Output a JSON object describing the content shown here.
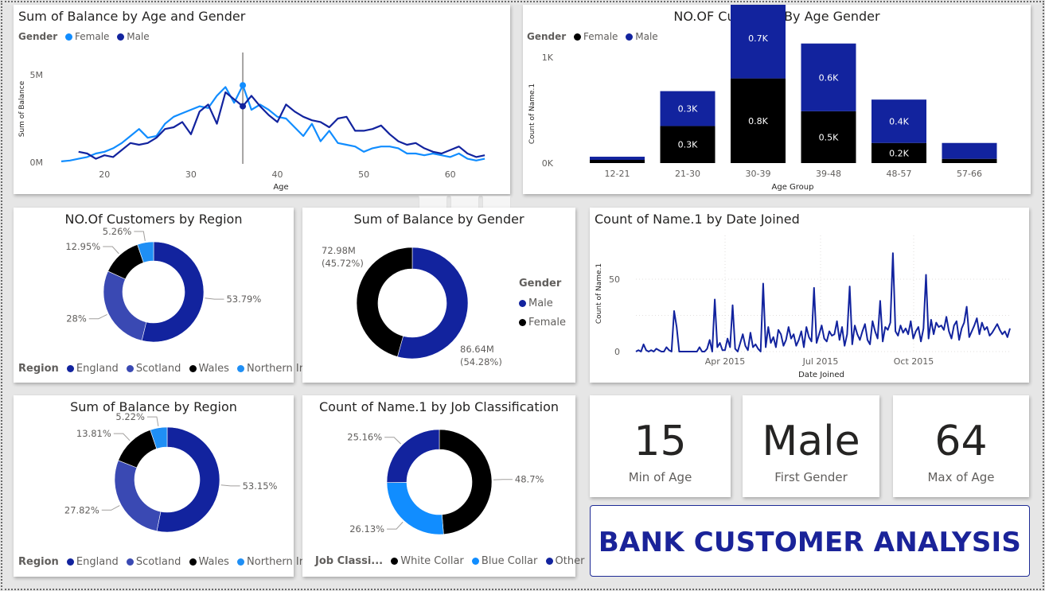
{
  "colors": {
    "female_light": "#118dff",
    "male_dark": "#12239e",
    "black": "#000000",
    "scotland": "#3a49b3",
    "northern_ireland": "#1f8ff5",
    "accent_text": "#1a2399"
  },
  "balance_age_gender": {
    "title": "Sum of Balance by Age and Gender",
    "legend_title": "Gender",
    "legend": [
      "Female",
      "Male"
    ],
    "ylabel": "Sum of Balance",
    "xlabel": "Age",
    "y_ticks": [
      "5M",
      "0M"
    ],
    "x_ticks": [
      "20",
      "30",
      "40",
      "50",
      "60"
    ]
  },
  "customers_age_gender": {
    "title": "NO.OF Customer By Age Gender",
    "legend_title": "Gender",
    "legend": [
      "Female",
      "Male"
    ],
    "ylabel": "Count of Name.1",
    "xlabel": "Age Group",
    "y_ticks": [
      "1K",
      "0K"
    ]
  },
  "customers_region": {
    "title": "NO.Of Customers by Region",
    "legend_title": "Region",
    "legend": [
      "England",
      "Scotland",
      "Wales",
      "Northern Ir..."
    ]
  },
  "balance_gender": {
    "title": "Sum of Balance by Gender",
    "legend_title": "Gender",
    "legend": [
      "Male",
      "Female"
    ],
    "label_female_1": "72.98M",
    "label_female_2": "(45.72%)",
    "label_male_1": "86.64M",
    "label_male_2": "(54.28%)"
  },
  "date_joined": {
    "title": "Count of Name.1 by Date Joined",
    "ylabel": "Count of Name.1",
    "xlabel": "Date Joined",
    "y_ticks": [
      "50",
      "0"
    ],
    "x_ticks": [
      "Apr 2015",
      "Jul 2015",
      "Oct 2015"
    ]
  },
  "balance_region": {
    "title": "Sum of Balance by Region",
    "legend_title": "Region",
    "legend": [
      "England",
      "Scotland",
      "Wales",
      "Northern Ir..."
    ]
  },
  "job_class": {
    "title": "Count of Name.1 by Job Classification",
    "legend_title": "Job Classi...",
    "legend": [
      "White Collar",
      "Blue Collar",
      "Other"
    ]
  },
  "cards": [
    {
      "value": "15",
      "label": "Min of Age"
    },
    {
      "value": "Male",
      "label": "First Gender"
    },
    {
      "value": "64",
      "label": "Max of Age"
    }
  ],
  "banner": "BANK CUSTOMER ANALYSIS",
  "chart_data": [
    {
      "type": "line",
      "title": "Sum of Balance by Age and Gender",
      "xlabel": "Age",
      "ylabel": "Sum of Balance",
      "xlim": [
        15,
        65
      ],
      "ylim": [
        0,
        6
      ],
      "unit": "M",
      "x": [
        15,
        16,
        17,
        18,
        19,
        20,
        21,
        22,
        23,
        24,
        25,
        26,
        27,
        28,
        29,
        30,
        31,
        32,
        33,
        34,
        35,
        36,
        37,
        38,
        39,
        40,
        41,
        42,
        43,
        44,
        45,
        46,
        47,
        48,
        49,
        50,
        51,
        52,
        53,
        54,
        55,
        56,
        57,
        58,
        59,
        60,
        61,
        62,
        63,
        64
      ],
      "series": [
        {
          "name": "Female",
          "color": "#118dff",
          "values": [
            0.05,
            0.1,
            0.2,
            0.3,
            0.5,
            0.6,
            0.8,
            1.1,
            1.5,
            1.9,
            1.4,
            1.5,
            2.2,
            2.6,
            2.8,
            3.0,
            3.2,
            3.1,
            3.8,
            4.3,
            3.4,
            4.4,
            3.0,
            3.3,
            3.0,
            2.6,
            2.5,
            2.0,
            1.5,
            2.2,
            1.2,
            1.8,
            1.1,
            1.0,
            0.9,
            0.6,
            0.8,
            0.9,
            0.9,
            0.8,
            0.5,
            0.5,
            0.4,
            0.5,
            0.4,
            0.3,
            0.5,
            0.2,
            0.1,
            0.2
          ]
        },
        {
          "name": "Male",
          "color": "#12239e",
          "values": [
            null,
            null,
            0.6,
            0.5,
            0.2,
            0.4,
            0.3,
            0.7,
            1.1,
            1.0,
            1.1,
            1.4,
            1.9,
            2.0,
            2.3,
            1.6,
            2.9,
            3.3,
            2.2,
            4.0,
            3.6,
            3.2,
            3.8,
            3.2,
            2.7,
            2.3,
            3.3,
            2.9,
            2.6,
            2.4,
            2.3,
            2.0,
            2.5,
            2.6,
            1.8,
            1.8,
            1.9,
            2.1,
            1.6,
            1.2,
            1.0,
            1.1,
            0.8,
            0.6,
            0.5,
            0.7,
            0.9,
            0.5,
            0.3,
            0.4
          ]
        }
      ]
    },
    {
      "type": "bar",
      "title": "NO.OF Customer By Age Gender",
      "xlabel": "Age Group",
      "ylabel": "Count of Name.1",
      "categories": [
        "12-21",
        "21-30",
        "30-39",
        "39-48",
        "48-57",
        "57-66"
      ],
      "stacked": true,
      "ylim": [
        0,
        1600
      ],
      "series": [
        {
          "name": "Female",
          "color": "#000000",
          "values": [
            30,
            350,
            800,
            490,
            190,
            40
          ],
          "labels": [
            "",
            "0.3K",
            "0.8K",
            "0.5K",
            "0.2K",
            ""
          ]
        },
        {
          "name": "Male",
          "color": "#12239e",
          "values": [
            30,
            330,
            760,
            640,
            410,
            150
          ],
          "labels": [
            "",
            "0.3K",
            "0.7K",
            "0.6K",
            "0.4K",
            ""
          ]
        }
      ]
    },
    {
      "type": "pie",
      "title": "NO.Of Customers by Region",
      "categories": [
        "England",
        "Scotland",
        "Wales",
        "Northern Ir..."
      ],
      "values": [
        53.79,
        28,
        12.95,
        5.26
      ],
      "labels": [
        "53.79%",
        "28%",
        "12.95%",
        "5.26%"
      ],
      "colors": [
        "#12239e",
        "#3a49b3",
        "#000000",
        "#1f8ff5"
      ]
    },
    {
      "type": "pie",
      "title": "Sum of Balance by Gender",
      "categories": [
        "Male",
        "Female"
      ],
      "values": [
        86.64,
        72.98
      ],
      "percent": [
        54.28,
        45.72
      ],
      "colors": [
        "#12239e",
        "#000000"
      ]
    },
    {
      "type": "line",
      "title": "Count of Name.1 by Date Joined",
      "xlabel": "Date Joined",
      "ylabel": "Count of Name.1",
      "x_ticks": [
        "Apr 2015",
        "Jul 2015",
        "Oct 2015"
      ],
      "ylim": [
        0,
        70
      ],
      "series": [
        {
          "name": "",
          "color": "#12239e",
          "values": [
            0,
            1,
            0,
            5,
            1,
            0,
            1,
            0,
            2,
            1,
            0,
            0,
            3,
            1,
            0,
            28,
            17,
            0,
            0,
            0,
            0,
            0,
            0,
            0,
            0,
            3,
            0,
            0,
            2,
            8,
            0,
            36,
            3,
            6,
            1,
            1,
            9,
            3,
            32,
            2,
            0,
            6,
            12,
            4,
            1,
            13,
            3,
            5,
            2,
            0,
            47,
            3,
            17,
            6,
            10,
            3,
            15,
            12,
            4,
            8,
            17,
            9,
            12,
            4,
            8,
            14,
            3,
            17,
            10,
            7,
            44,
            6,
            12,
            18,
            9,
            7,
            14,
            11,
            12,
            21,
            8,
            17,
            4,
            12,
            45,
            5,
            18,
            12,
            8,
            14,
            19,
            8,
            5,
            21,
            14,
            9,
            35,
            7,
            17,
            15,
            20,
            68,
            14,
            11,
            18,
            13,
            16,
            12,
            21,
            9,
            14,
            17,
            7,
            16,
            53,
            9,
            22,
            12,
            20,
            17,
            18,
            15,
            24,
            14,
            9,
            18,
            21,
            8,
            16,
            20,
            31,
            10,
            14,
            18,
            23,
            12,
            20,
            15,
            17,
            11,
            13,
            16,
            19,
            15,
            12,
            14,
            10,
            16
          ]
        }
      ]
    },
    {
      "type": "pie",
      "title": "Sum of Balance by Region",
      "categories": [
        "England",
        "Scotland",
        "Wales",
        "Northern Ir..."
      ],
      "values": [
        53.15,
        27.82,
        13.81,
        5.22
      ],
      "labels": [
        "53.15%",
        "27.82%",
        "13.81%",
        "5.22%"
      ],
      "colors": [
        "#12239e",
        "#3a49b3",
        "#000000",
        "#1f8ff5"
      ]
    },
    {
      "type": "pie",
      "title": "Count of Name.1 by Job Classification",
      "categories": [
        "White Collar",
        "Blue Collar",
        "Other"
      ],
      "values": [
        48.7,
        26.13,
        25.16
      ],
      "labels": [
        "48.7%",
        "26.13%",
        "25.16%"
      ],
      "colors": [
        "#000000",
        "#118dff",
        "#12239e"
      ]
    }
  ]
}
